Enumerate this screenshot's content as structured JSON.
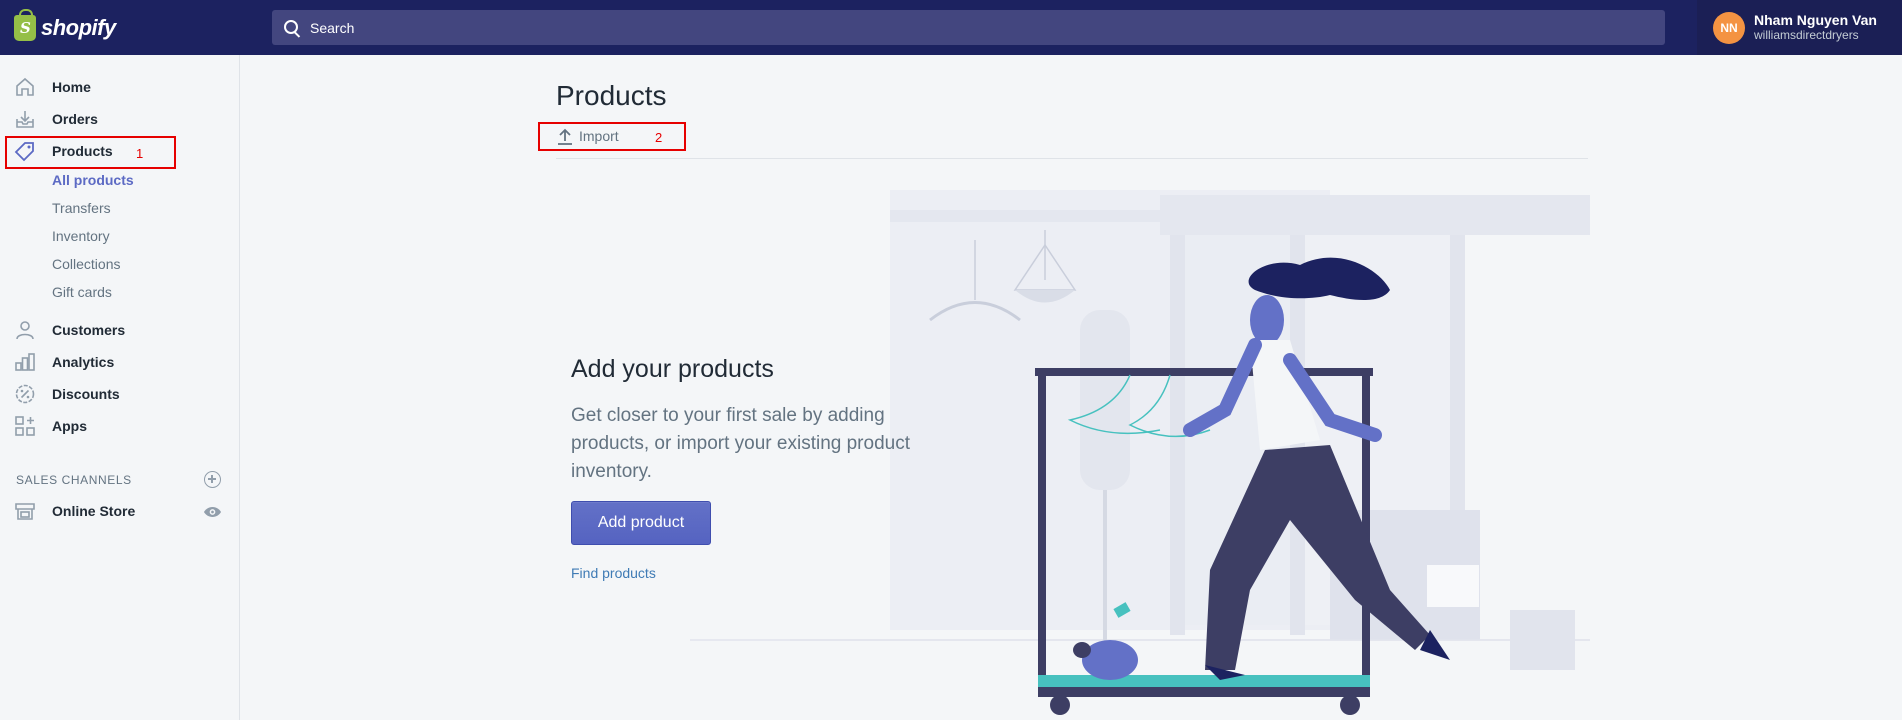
{
  "header": {
    "logo_text": "shopify",
    "logo_letter": "S",
    "search_placeholder": "Search",
    "account": {
      "initials": "NN",
      "name": "Nham Nguyen Van",
      "store": "williamsdirectdryers"
    }
  },
  "sidebar": {
    "items": [
      {
        "label": "Home",
        "icon": "home-icon"
      },
      {
        "label": "Orders",
        "icon": "orders-icon"
      },
      {
        "label": "Products",
        "icon": "tag-icon"
      },
      {
        "label": "Customers",
        "icon": "person-icon"
      },
      {
        "label": "Analytics",
        "icon": "bar-chart-icon"
      },
      {
        "label": "Discounts",
        "icon": "discount-icon"
      },
      {
        "label": "Apps",
        "icon": "apps-icon"
      }
    ],
    "product_subitems": [
      "All products",
      "Transfers",
      "Inventory",
      "Collections",
      "Gift cards"
    ],
    "sales_channels_label": "SALES CHANNELS",
    "online_store_label": "Online Store"
  },
  "annotations": {
    "label_1": "1",
    "label_2": "2"
  },
  "main": {
    "title": "Products",
    "import_label": "Import",
    "empty_state": {
      "heading": "Add your products",
      "body": "Get closer to your first sale by adding products, or import your existing product inventory.",
      "primary_button": "Add product",
      "secondary_link": "Find products"
    }
  },
  "colors": {
    "topbar": "#1c2260",
    "search": "#43467f",
    "accent": "#5c6ac4",
    "avatar": "#f49342",
    "annotation": "#e60000"
  }
}
